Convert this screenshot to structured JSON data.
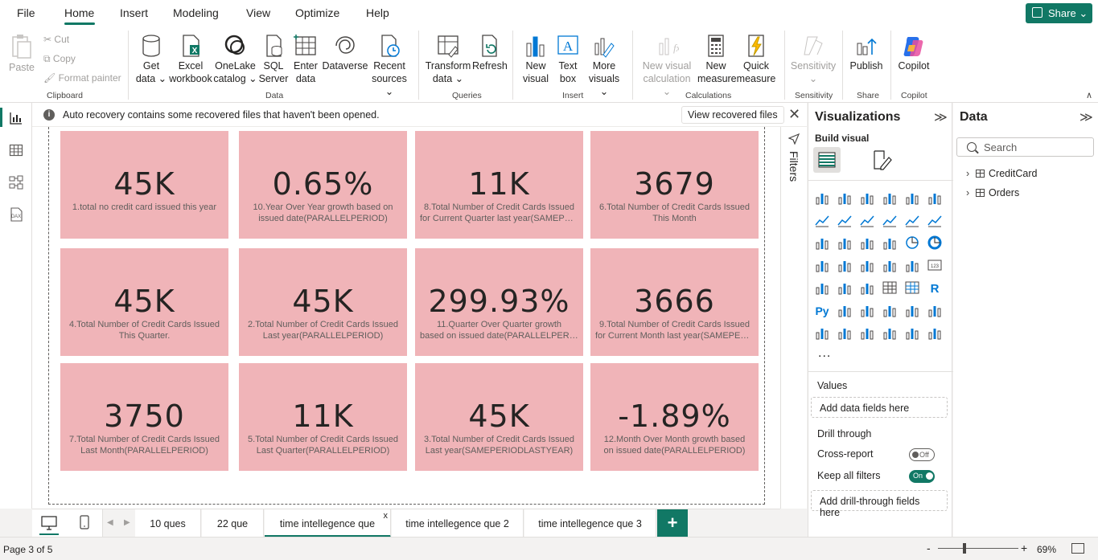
{
  "menu": {
    "items": [
      "File",
      "Home",
      "Insert",
      "Modeling",
      "View",
      "Optimize",
      "Help"
    ],
    "share_label": "Share"
  },
  "ribbon": {
    "clipboard": {
      "paste": "Paste",
      "cut": "Cut",
      "copy": "Copy",
      "format_painter": "Format painter",
      "group": "Clipboard"
    },
    "data": {
      "get_data": [
        "Get",
        "data ⌄"
      ],
      "excel": [
        "Excel",
        "workbook"
      ],
      "onelake": [
        "OneLake",
        "catalog ⌄"
      ],
      "sql": [
        "SQL",
        "Server"
      ],
      "enter": [
        "Enter",
        "data"
      ],
      "dataverse": "Dataverse",
      "recent": [
        "Recent",
        "sources ⌄"
      ],
      "group": "Data"
    },
    "queries": {
      "transform": [
        "Transform",
        "data ⌄"
      ],
      "refresh": "Refresh",
      "group": "Queries"
    },
    "insert": {
      "new_visual": [
        "New",
        "visual"
      ],
      "text_box": [
        "Text",
        "box"
      ],
      "more_visuals": [
        "More",
        "visuals ⌄"
      ],
      "group": "Insert"
    },
    "calculations": {
      "new_visual_calc": [
        "New visual",
        "calculation ⌄"
      ],
      "new_measure": [
        "New",
        "measure"
      ],
      "quick_measure": [
        "Quick",
        "measure"
      ],
      "group": "Calculations"
    },
    "sensitivity": {
      "label": "Sensitivity",
      "sub": "⌄",
      "group": "Sensitivity"
    },
    "share": {
      "publish": "Publish",
      "group": "Share"
    },
    "copilot": {
      "label": "Copilot",
      "group": "Copilot"
    }
  },
  "notification": {
    "message": "Auto recovery contains some recovered files that haven't been opened.",
    "button": "View recovered files",
    "close": "✕"
  },
  "cards": [
    {
      "value": "45K",
      "label": [
        "1.total no credit card issued this year"
      ]
    },
    {
      "value": "45K",
      "label": [
        "4.Total Number of Credit Cards Issued",
        "This Quarter."
      ]
    },
    {
      "value": "3750",
      "label": [
        "7.Total Number of Credit Cards Issued",
        "Last Month(PARALLELPERIOD)"
      ]
    },
    {
      "value": "0.65%",
      "label": [
        "10.Year Over Year growth based on",
        "issued date(PARALLELPERIOD)"
      ]
    },
    {
      "value": "45K",
      "label": [
        "2.Total Number of Credit Cards Issued",
        "Last year(PARALLELPERIOD)"
      ]
    },
    {
      "value": "11K",
      "label": [
        "5.Total Number of Credit Cards Issued",
        "Last Quarter(PARALLELPERIOD)"
      ]
    },
    {
      "value": "11K",
      "label": [
        "8.Total Number of Credit Cards Issued",
        "for Current Quarter last year(SAMEPER..."
      ]
    },
    {
      "value": "299.93%",
      "label": [
        "11.Quarter Over Quarter growth",
        "based on issued date(PARALLELPERIOD)"
      ]
    },
    {
      "value": "45K",
      "label": [
        "3.Total Number of Credit Cards Issued",
        "Last year(SAMEPERIODLASTYEAR)"
      ]
    },
    {
      "value": "3679",
      "label": [
        "6.Total Number of Credit Cards Issued",
        "This Month"
      ]
    },
    {
      "value": "3666",
      "label": [
        "9.Total Number of Credit Cards Issued",
        "for Current Month last year(SAMEPERI..."
      ]
    },
    {
      "value": "-1.89%",
      "label": [
        "12.Month Over Month growth based",
        "on issued date(PARALLELPERIOD)"
      ]
    }
  ],
  "filters": {
    "label": "Filters"
  },
  "visualizations": {
    "title": "Visualizations",
    "build_visual": "Build visual",
    "more": "...",
    "values_label": "Values",
    "values_placeholder": "Add data fields here",
    "drill_through": "Drill through",
    "cross_report": "Cross-report",
    "cross_report_state": "Off",
    "keep_all_filters": "Keep all filters",
    "keep_all_filters_state": "On",
    "drill_placeholder": "Add drill-through fields here"
  },
  "data_pane": {
    "title": "Data",
    "search_placeholder": "Search",
    "tables": [
      "CreditCard",
      "Orders"
    ]
  },
  "tabs": {
    "items": [
      "10 ques",
      "22 que",
      "time intellegence que",
      "time intellegence que 2",
      "time intellegence que 3"
    ],
    "active_index": 2,
    "close": "x",
    "add": "+"
  },
  "status": {
    "page": "Page 3 of 5",
    "zoom": "69%",
    "zoom_level": 0.69
  },
  "colors": {
    "accent": "#117865",
    "card": "#f0b4b8"
  }
}
